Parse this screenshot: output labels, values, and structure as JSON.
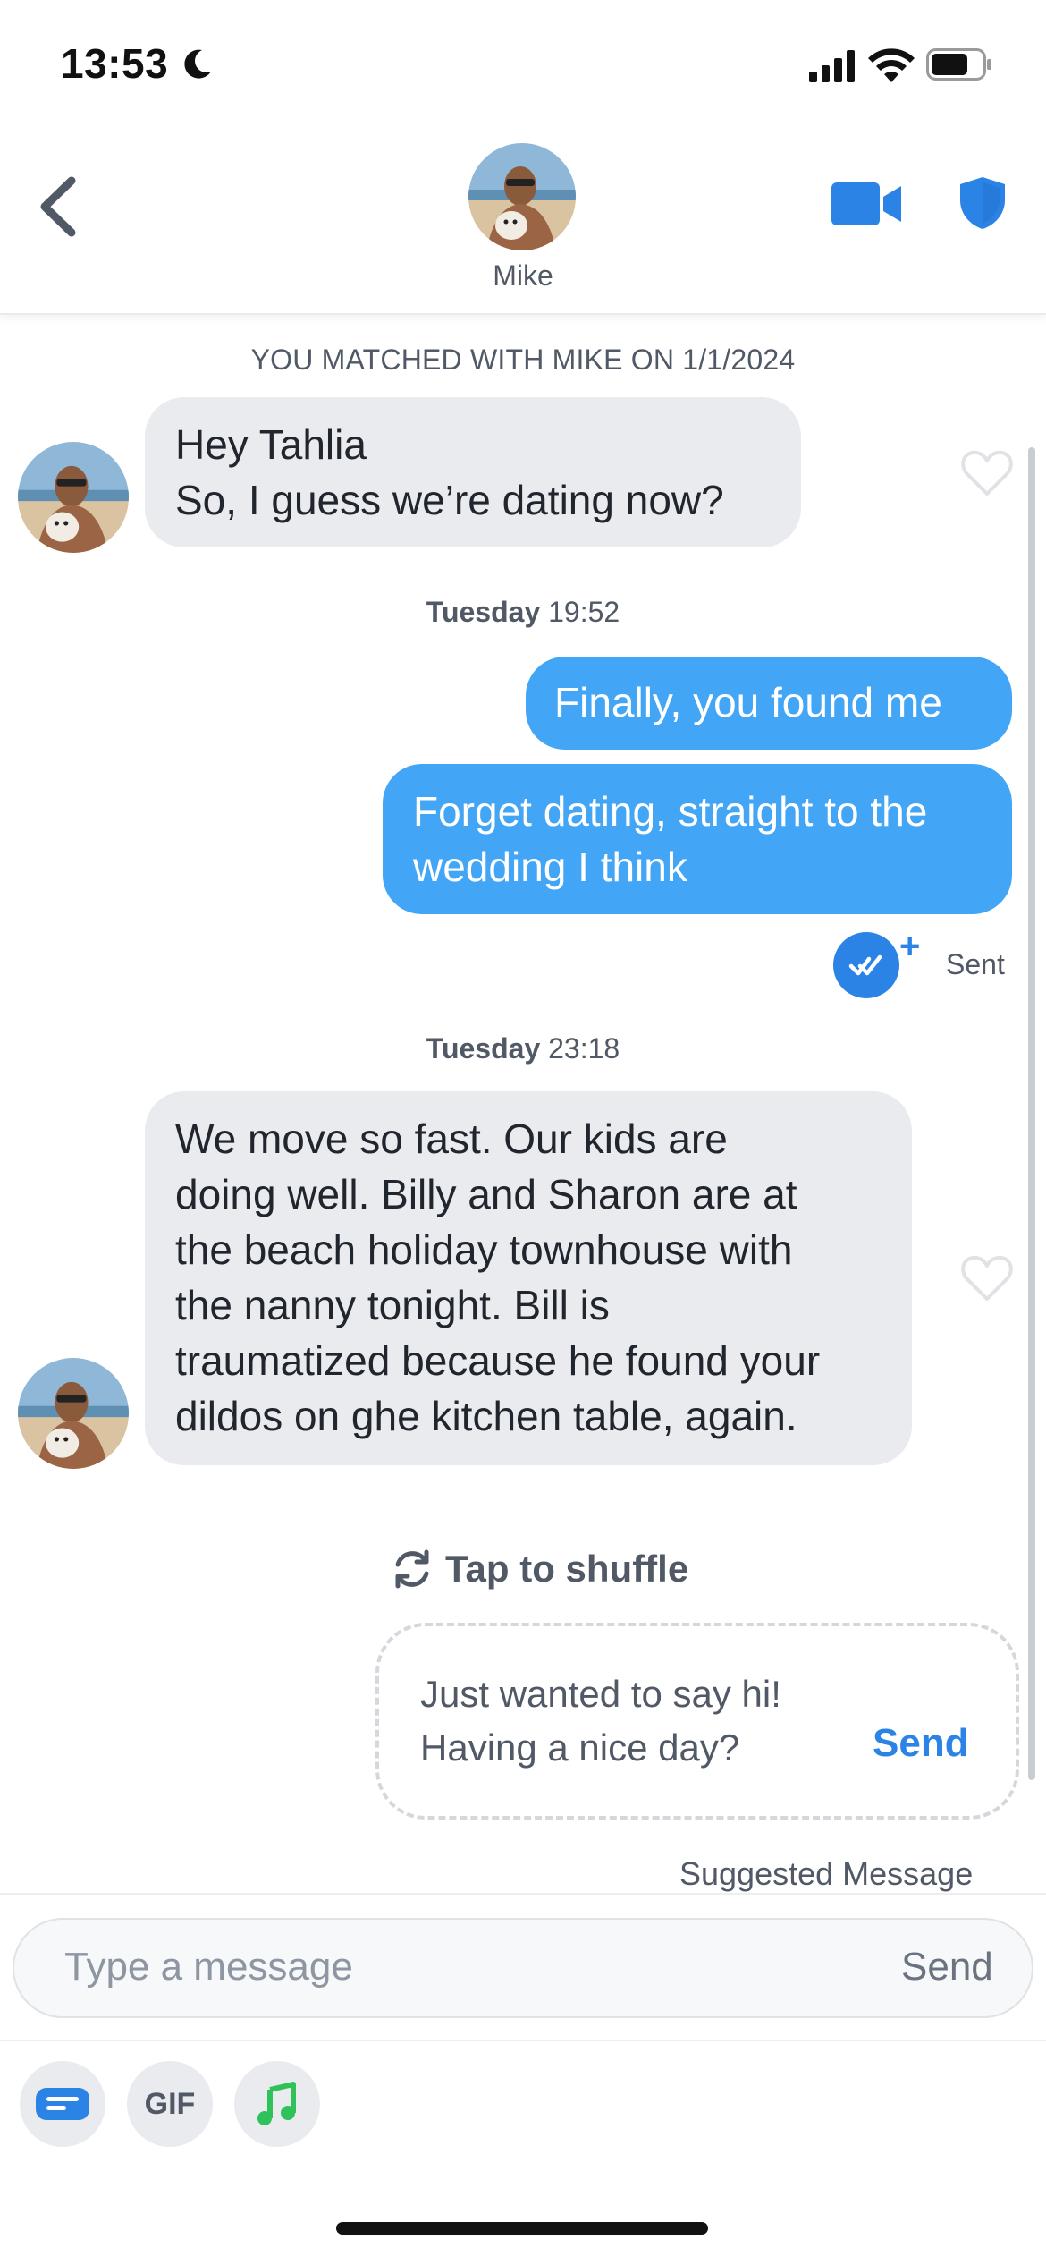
{
  "status_bar": {
    "time": "13:53"
  },
  "header": {
    "contact_name": "Mike"
  },
  "conversation": {
    "match_banner": "YOU MATCHED WITH MIKE ON 1/1/2024",
    "messages": [
      {
        "from": "them",
        "lines": [
          "Hey Tahlia",
          "So, I guess we’re dating now?"
        ]
      },
      {
        "type": "timestamp",
        "day": "Tuesday",
        "time": "19:52"
      },
      {
        "from": "me",
        "lines": [
          "Finally, you found me"
        ]
      },
      {
        "from": "me",
        "lines": [
          "Forget dating, straight to the",
          "wedding I think"
        ]
      },
      {
        "type": "status",
        "text": "Sent"
      },
      {
        "type": "timestamp",
        "day": "Tuesday",
        "time": "23:18"
      },
      {
        "from": "them",
        "lines": [
          "We move so fast. Our kids are",
          "doing well. Billy and Sharon are at",
          "the beach holiday townhouse with",
          "the nanny tonight. Bill is",
          "traumatized because he found your",
          "dildos on ghe kitchen table, again."
        ]
      }
    ]
  },
  "suggestion": {
    "shuffle_label": "Tap to shuffle",
    "text_line1": "Just wanted to say hi!",
    "text_line2": "Having a nice day?",
    "send_label": "Send",
    "caption": "Suggested Message"
  },
  "composer": {
    "placeholder": "Type a message",
    "send_label": "Send"
  },
  "toolbar": {
    "gif_label": "GIF"
  },
  "colors": {
    "accent": "#2b83e6",
    "outgoing_bubble": "#42a5f5",
    "incoming_bubble": "#e9ebee",
    "music_icon": "#2fc25b"
  }
}
